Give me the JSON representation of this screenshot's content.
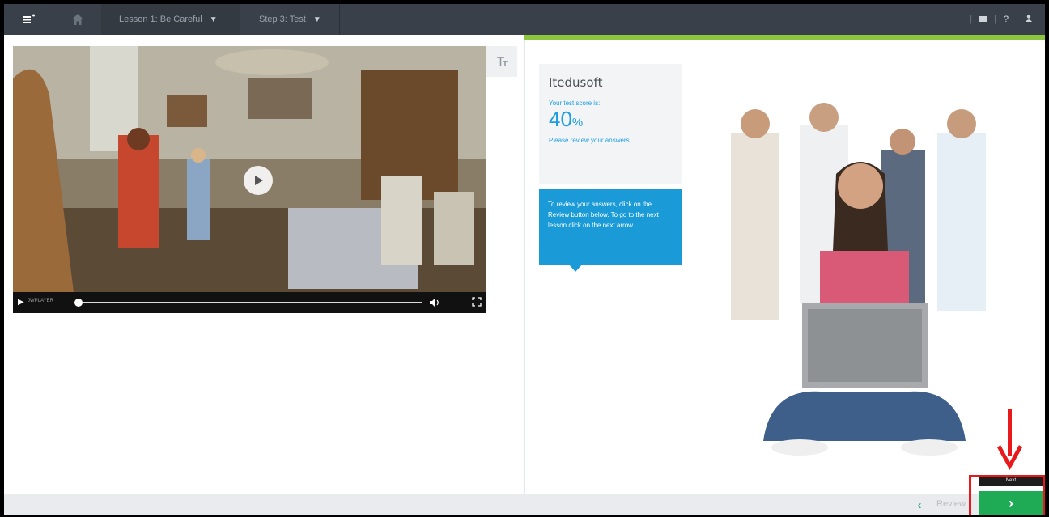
{
  "topbar": {
    "lesson_label": "Lesson 1: Be Careful",
    "step_label": "Step 3: Test",
    "help_label": "?",
    "colors": {
      "bar": "#3a4049"
    }
  },
  "video": {
    "brand_label": "JWPLAYER",
    "icons": [
      "play-icon",
      "volume-icon",
      "fullscreen-icon"
    ]
  },
  "score": {
    "brand": "Itedusoft",
    "label": "Your test score is:",
    "value": "40",
    "unit": "%",
    "message": "Please review your answers.",
    "tip": "To review your answers, click on the Review button below. To go to the next lesson click on the next arrow.",
    "colors": {
      "accent": "#1c9ee0",
      "tip_bg": "#1a9ad6"
    }
  },
  "footer": {
    "prev_icon": "‹",
    "review_label": "Review",
    "next_icon": "›",
    "next_tooltip": "Next",
    "colors": {
      "next_bg": "#1faa55",
      "highlight": "#e8181b"
    }
  }
}
